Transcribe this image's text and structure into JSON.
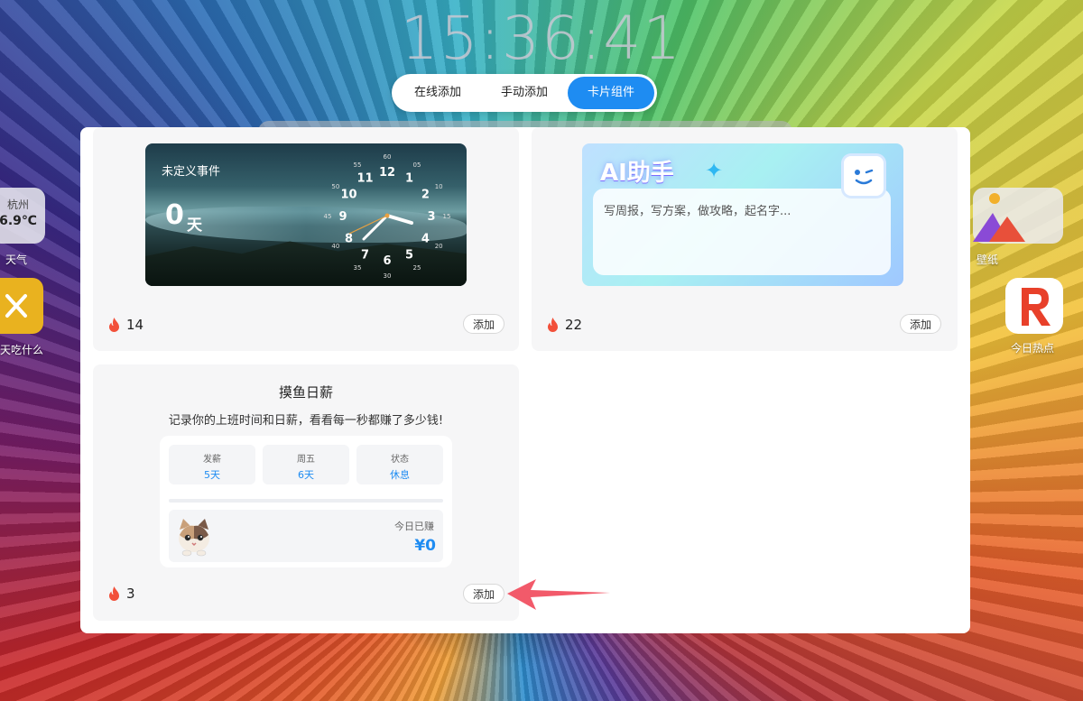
{
  "clock": {
    "time": "15:36:41"
  },
  "tabs": [
    {
      "label": "在线添加",
      "active": false
    },
    {
      "label": "手动添加",
      "active": false
    },
    {
      "label": "卡片组件",
      "active": true
    }
  ],
  "desktop": {
    "weather": {
      "city": "杭州",
      "temp": "6.9℃",
      "label": "天气"
    },
    "food": {
      "label": "天吃什么"
    },
    "wallpaper": {
      "label": "壁纸"
    },
    "hot": {
      "label": "今日热点"
    }
  },
  "cards": [
    {
      "widget": {
        "label": "未定义事件",
        "days": "0",
        "unit": "天",
        "clock_numbers": [
          "12",
          "1",
          "2",
          "3",
          "4",
          "5",
          "6",
          "7",
          "8",
          "9",
          "10",
          "11"
        ],
        "clock_minutes": [
          "60",
          "05",
          "10",
          "15",
          "20",
          "25",
          "30",
          "35",
          "40",
          "45",
          "50",
          "55"
        ]
      },
      "hot_count": "14",
      "add_label": "添加"
    },
    {
      "widget": {
        "title": "AI助手",
        "placeholder": "写周报，写方案，做攻略，起名字..."
      },
      "hot_count": "22",
      "add_label": "添加"
    },
    {
      "title": "摸鱼日薪",
      "subtitle": "记录你的上班时间和日薪，看看每一秒都赚了多少钱!",
      "widget": {
        "stats": [
          {
            "key": "发薪",
            "value": "5天"
          },
          {
            "key": "周五",
            "value": "6天"
          },
          {
            "key": "状态",
            "value": "休息"
          }
        ],
        "earned_label": "今日已赚",
        "earned_value": "¥0"
      },
      "hot_count": "3",
      "add_label": "添加"
    }
  ],
  "colors": {
    "accent": "#1e8cf2",
    "arrow": "#f25a6a",
    "fire": "#f2503a"
  }
}
